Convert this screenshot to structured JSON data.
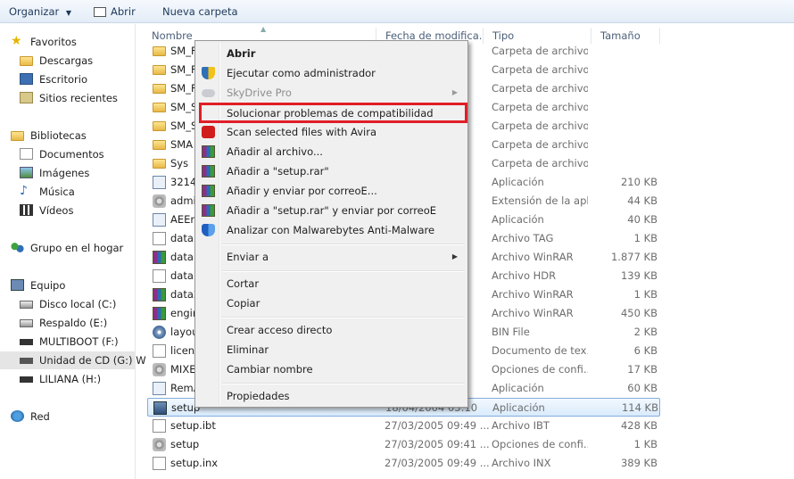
{
  "toolbar": {
    "organize_label": "Organizar",
    "open_label": "Abrir",
    "new_folder_label": "Nueva carpeta"
  },
  "nav": {
    "favorites": "Favoritos",
    "downloads": "Descargas",
    "desktop": "Escritorio",
    "recent": "Sitios recientes",
    "libraries": "Bibliotecas",
    "documents": "Documentos",
    "images": "Imágenes",
    "music": "Música",
    "videos": "Vídeos",
    "homegroup": "Grupo en el hogar",
    "computer": "Equipo",
    "local_disk": "Disco local (C:)",
    "backup": "Respaldo (E:)",
    "multiboot": "MULTIBOOT (F:)",
    "cd_drive": "Unidad de CD (G:) W",
    "liliana": "LILIANA (H:)",
    "network": "Red"
  },
  "columns": {
    "name": "Nombre",
    "date": "Fecha de modifica...",
    "type": "Tipo",
    "size": "Tamaño"
  },
  "files": [
    {
      "name": "SM_F",
      "date": "",
      "type": "Carpeta de archivos",
      "size": "",
      "icon": "folder"
    },
    {
      "name": "SM_F",
      "date": "",
      "type": "Carpeta de archivos",
      "size": "",
      "icon": "folder"
    },
    {
      "name": "SM_F",
      "date": "",
      "type": "Carpeta de archivos",
      "size": "",
      "icon": "folder"
    },
    {
      "name": "SM_S",
      "date": "",
      "type": "Carpeta de archivos",
      "size": "",
      "icon": "folder"
    },
    {
      "name": "SM_S",
      "date": "",
      "type": "Carpeta de archivos",
      "size": "",
      "icon": "folder"
    },
    {
      "name": "SMA",
      "date": "",
      "type": "Carpeta de archivos",
      "size": "",
      "icon": "folder"
    },
    {
      "name": "Sys",
      "date": "",
      "type": "Carpeta de archivos",
      "size": "",
      "icon": "folder"
    },
    {
      "name": "32146",
      "date": "",
      "type": "Aplicación",
      "size": "210 KB",
      "icon": "app"
    },
    {
      "name": "admi",
      "date": "",
      "type": "Extensión de la apl...",
      "size": "44 KB",
      "icon": "gear"
    },
    {
      "name": "AEEn",
      "date": "",
      "type": "Aplicación",
      "size": "40 KB",
      "icon": "app"
    },
    {
      "name": "data.",
      "date": "",
      "type": "Archivo TAG",
      "size": "1 KB",
      "icon": "doc"
    },
    {
      "name": "data1",
      "date": "",
      "type": "Archivo WinRAR",
      "size": "1.877 KB",
      "icon": "rar"
    },
    {
      "name": "data1",
      "date": "",
      "type": "Archivo HDR",
      "size": "139 KB",
      "icon": "doc"
    },
    {
      "name": "data2",
      "date": "",
      "type": "Archivo WinRAR",
      "size": "1 KB",
      "icon": "rar"
    },
    {
      "name": "engin",
      "date": "",
      "type": "Archivo WinRAR",
      "size": "450 KB",
      "icon": "rar"
    },
    {
      "name": "layou",
      "date": "",
      "type": "BIN File",
      "size": "2 KB",
      "icon": "cd"
    },
    {
      "name": "licen",
      "date": "",
      "type": "Documento de tex...",
      "size": "6 KB",
      "icon": "doc"
    },
    {
      "name": "MIXE",
      "date": "",
      "type": "Opciones de confi...",
      "size": "17 KB",
      "icon": "gear"
    },
    {
      "name": "RemA",
      "date": "",
      "type": "Aplicación",
      "size": "60 KB",
      "icon": "app"
    },
    {
      "name": "setup",
      "date": "18/04/2004 05:10",
      "type": "Aplicación",
      "size": "114 KB",
      "icon": "setup",
      "selected": true
    },
    {
      "name": "setup.ibt",
      "date": "27/03/2005 09:49 ...",
      "type": "Archivo IBT",
      "size": "428 KB",
      "icon": "doc"
    },
    {
      "name": "setup",
      "date": "27/03/2005 09:41 ...",
      "type": "Opciones de confi...",
      "size": "1 KB",
      "icon": "gear"
    },
    {
      "name": "setup.inx",
      "date": "27/03/2005 09:49 ...",
      "type": "Archivo INX",
      "size": "389 KB",
      "icon": "doc"
    }
  ],
  "context_menu": {
    "open": "Abrir",
    "run_admin": "Ejecutar como administrador",
    "skydrive": "SkyDrive Pro",
    "compat": "Solucionar problemas de compatibilidad",
    "avira": "Scan selected files with Avira",
    "add_archive": "Añadir al archivo...",
    "add_setup_rar": "Añadir a \"setup.rar\"",
    "add_email": "Añadir y enviar por correoE...",
    "add_setup_rar_email": "Añadir a \"setup.rar\" y enviar por correoE",
    "malwarebytes": "Analizar con Malwarebytes Anti-Malware",
    "send_to": "Enviar a",
    "cut": "Cortar",
    "copy": "Copiar",
    "create_shortcut": "Crear acceso directo",
    "delete": "Eliminar",
    "rename": "Cambiar nombre",
    "properties": "Propiedades"
  },
  "colors": {
    "highlight_box": "#e01e26",
    "selection": "#d9ebfc"
  }
}
